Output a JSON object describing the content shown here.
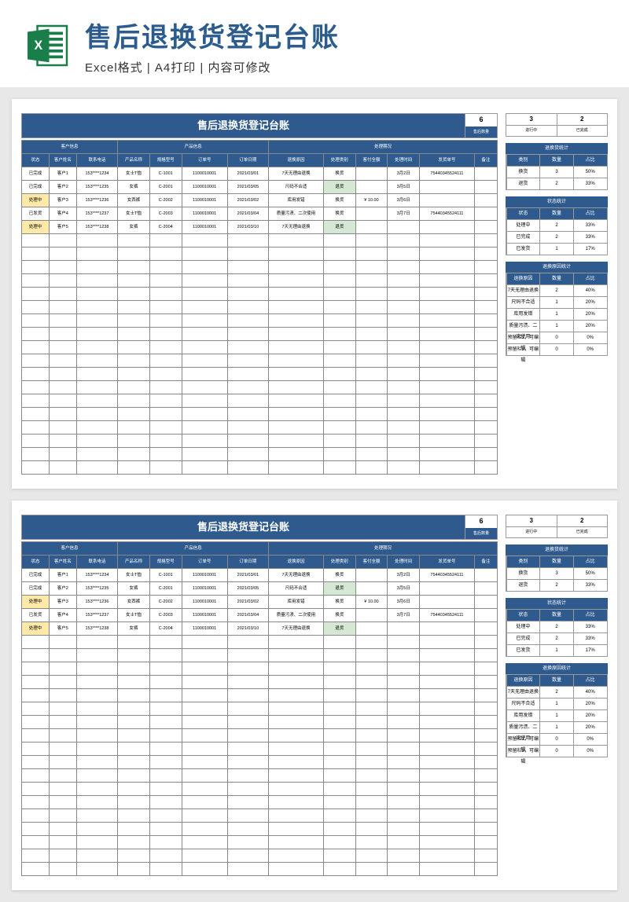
{
  "header": {
    "title": "售后退换货登记台账",
    "subtitle": "Excel格式 | A4打印 | 内容可修改"
  },
  "banner": {
    "title": "售后退换货登记台账",
    "count_num": "6",
    "count_lbl": "售后数量"
  },
  "top_pair": {
    "a_num": "3",
    "a_lbl": "进行中",
    "b_num": "2",
    "b_lbl": "已完成"
  },
  "groups": {
    "cust": "客户信息",
    "prod": "产品信息",
    "proc": "处理期况"
  },
  "cols": [
    "状态",
    "客户姓名",
    "联系电话",
    "产品名称",
    "规格型号",
    "订单号",
    "订单日期",
    "退换原因",
    "处理类别",
    "客付全额",
    "处理时间",
    "发货单号",
    "备注"
  ],
  "rows": [
    {
      "status": "已完成",
      "cls": "",
      "name": "客户1",
      "phone": "153****1234",
      "prod": "女士T恤",
      "spec": "C-1001",
      "order": "1100010001",
      "date": "2021/03/01",
      "reason": "7天无理由退换",
      "type": "换货",
      "amt": "",
      "time": "3月2日",
      "ship": "75440345524111",
      "note": ""
    },
    {
      "status": "已完成",
      "cls": "",
      "name": "客户2",
      "phone": "153****1235",
      "prod": "女裤",
      "spec": "C-2001",
      "order": "1100010001",
      "date": "2021/03/05",
      "reason": "尺码不合适",
      "type": "退货",
      "tcls": "hl-ret",
      "amt": "",
      "time": "3月5日",
      "ship": "",
      "note": ""
    },
    {
      "status": "处理中",
      "cls": "st-proc",
      "name": "客户3",
      "phone": "153****1236",
      "prod": "女西裤",
      "spec": "C-2002",
      "order": "1100010001",
      "date": "2021/03/02",
      "reason": "库用发错",
      "type": "换货",
      "amt": "¥ 10.00",
      "time": "3月6日",
      "ship": "",
      "note": ""
    },
    {
      "status": "已发货",
      "cls": "",
      "name": "客户4",
      "phone": "153****1237",
      "prod": "女士T恤",
      "spec": "C-2003",
      "order": "1100010001",
      "date": "2021/03/04",
      "reason": "质量污渍、二次使用",
      "type": "换货",
      "amt": "",
      "time": "3月7日",
      "ship": "75440345524111",
      "note": ""
    },
    {
      "status": "处理中",
      "cls": "st-proc",
      "name": "客户5",
      "phone": "153****1238",
      "prod": "女裤",
      "spec": "C-2004",
      "order": "1100010001",
      "date": "2021/03/10",
      "reason": "7天无理由退换",
      "type": "退货",
      "tcls": "hl-ret",
      "amt": "",
      "time": "",
      "ship": "",
      "note": ""
    }
  ],
  "stat_type": {
    "title": "退换货统计",
    "hdr": [
      "类别",
      "数量",
      "占比"
    ],
    "rows": [
      [
        "换货",
        "3",
        "50%"
      ],
      [
        "退货",
        "2",
        "33%"
      ]
    ]
  },
  "stat_status": {
    "title": "状态统计",
    "hdr": [
      "状态",
      "数量",
      "占比"
    ],
    "rows": [
      [
        "处理中",
        "2",
        "33%"
      ],
      [
        "已完成",
        "2",
        "33%"
      ],
      [
        "已发货",
        "1",
        "17%"
      ]
    ]
  },
  "stat_reason": {
    "title": "退换原因统计",
    "hdr": [
      "退换原因",
      "数量",
      "占比"
    ],
    "rows": [
      [
        "7天无理由退换",
        "2",
        "40%"
      ],
      [
        "尺码不合适",
        "1",
        "20%"
      ],
      [
        "库用发错",
        "1",
        "20%"
      ],
      [
        "质量污渍、二次使用",
        "1",
        "20%"
      ],
      [
        "预留栏1，可编辑",
        "0",
        "0%"
      ],
      [
        "预留栏2，可编辑",
        "0",
        "0%"
      ]
    ]
  },
  "empty_rows": 18
}
